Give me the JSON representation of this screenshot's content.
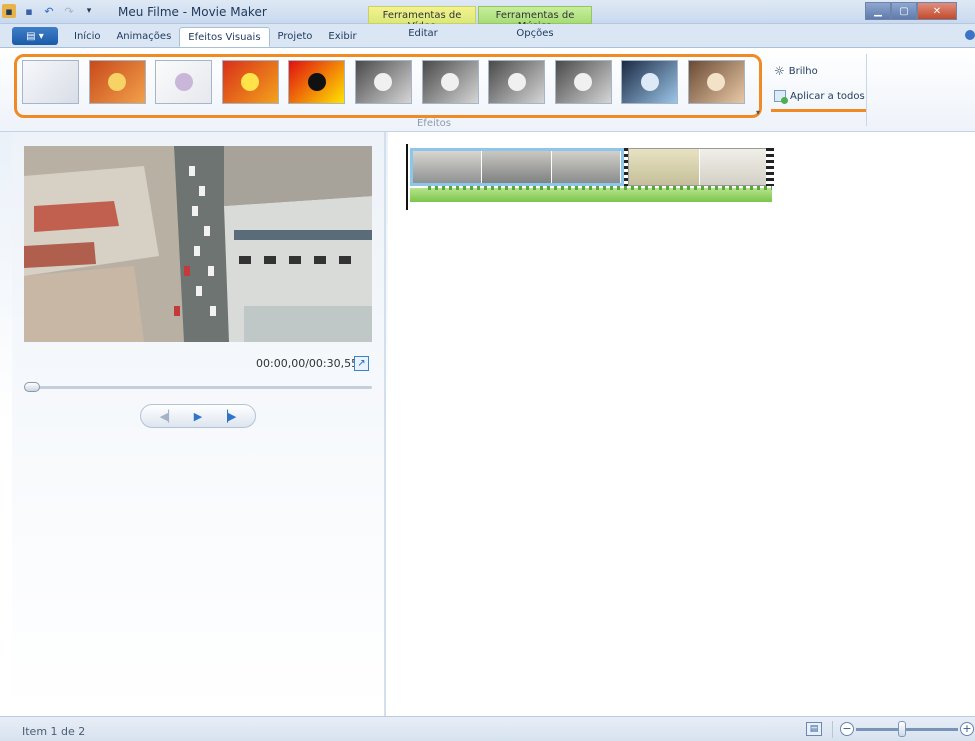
{
  "window": {
    "title": "Meu Filme - Movie Maker",
    "contextual_tabs": [
      "Ferramentas de Vídeo",
      "Ferramentas de Música"
    ]
  },
  "ribbon_tabs": [
    "Início",
    "Animações",
    "Efeitos Visuais",
    "Projeto",
    "Exibir"
  ],
  "active_tab": "Efeitos Visuais",
  "contextual_subtabs": [
    "Editar",
    "Opções"
  ],
  "effects_gallery": {
    "group_label": "Efeitos",
    "items": [
      {
        "name": "effect-none",
        "style": "none"
      },
      {
        "name": "effect-warm",
        "style": "warm"
      },
      {
        "name": "effect-sketch",
        "style": "sketch"
      },
      {
        "name": "effect-saturate",
        "style": "saturate"
      },
      {
        "name": "effect-threshold",
        "style": "threshold"
      },
      {
        "name": "effect-gray-1",
        "style": "gray"
      },
      {
        "name": "effect-gray-2",
        "style": "gray"
      },
      {
        "name": "effect-gray-3",
        "style": "gray"
      },
      {
        "name": "effect-gray-4",
        "style": "gray"
      },
      {
        "name": "effect-cyan",
        "style": "cyan"
      },
      {
        "name": "effect-sepia",
        "style": "sepia"
      }
    ]
  },
  "ribbon_buttons": {
    "brightness": "Brilho",
    "apply_all": "Aplicar a todos"
  },
  "preview": {
    "timecode": "00:00,00/00:30,55",
    "seek_progress": 0.0
  },
  "status": {
    "item_text": "Item 1 de 2",
    "zoom_level": 0.45
  },
  "colors": {
    "highlight": "#f08a24",
    "accent": "#2f74c9"
  }
}
